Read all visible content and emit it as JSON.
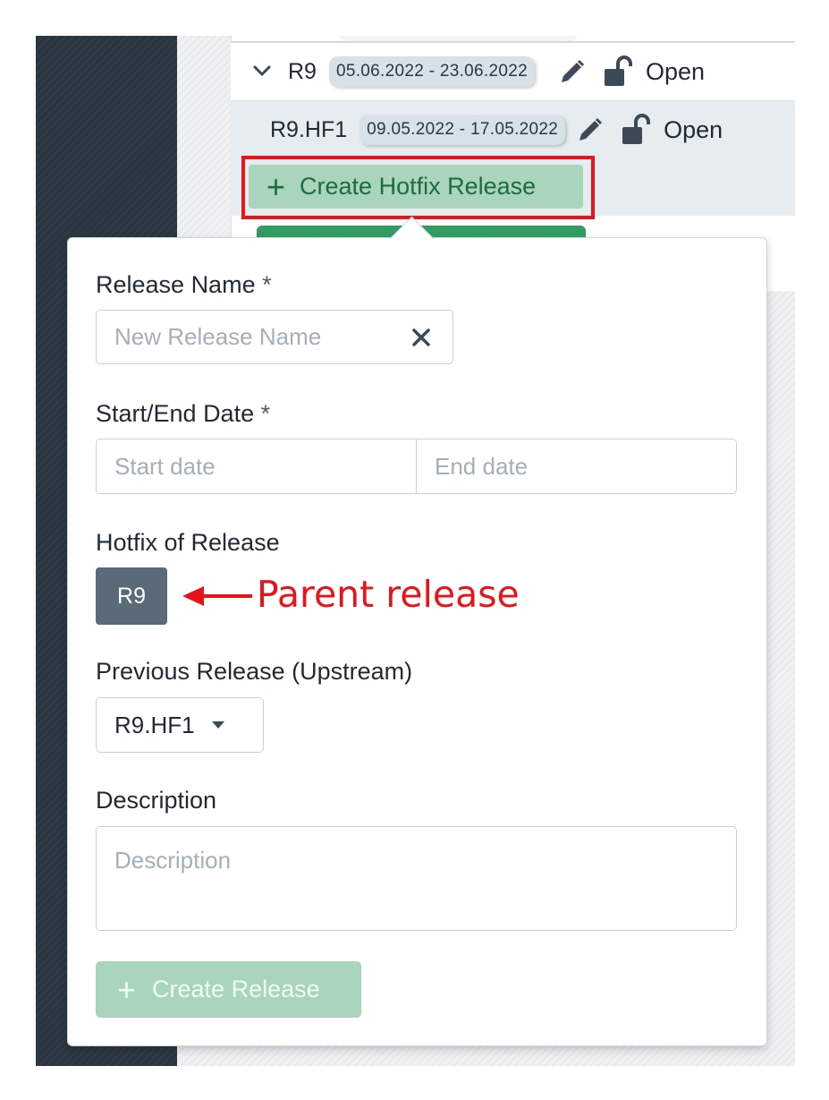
{
  "releases": [
    {
      "name": "R9",
      "dates": "05.06.2022 - 23.06.2022",
      "status": "Open"
    },
    {
      "name": "R9.HF1",
      "dates": "09.05.2022 - 17.05.2022",
      "status": "Open"
    }
  ],
  "hotfix_button": {
    "label": "Create Hotfix Release"
  },
  "form": {
    "release_name": {
      "label": "Release Name",
      "required_mark": "*",
      "placeholder": "New Release Name"
    },
    "dates": {
      "label": "Start/End Date",
      "required_mark": "*",
      "start_placeholder": "Start date",
      "end_placeholder": "End date"
    },
    "hotfix_of": {
      "label": "Hotfix of Release",
      "value": "R9"
    },
    "previous_release": {
      "label": "Previous Release (Upstream)",
      "value": "R9.HF1"
    },
    "description": {
      "label": "Description",
      "placeholder": "Description"
    },
    "submit": {
      "label": "Create Release"
    }
  },
  "annotation": {
    "text": "Parent release"
  },
  "colors": {
    "accent_green": "#a8d5bc",
    "annotation_red": "#e8141b",
    "chip": "#5a6a79"
  }
}
